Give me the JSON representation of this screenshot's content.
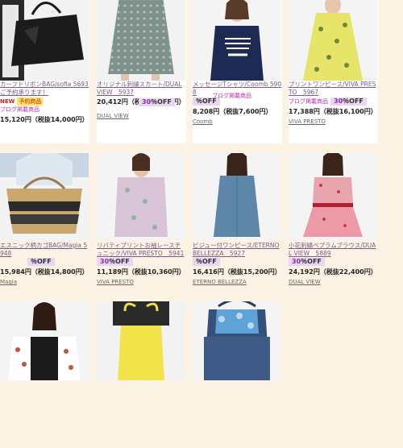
{
  "products": [
    {
      "title": "カーフドリボンBAG/sofia 5693 ご予約承ります！",
      "new_label": "NEW",
      "reserve_label": "予約商品",
      "blog_label": "ブログ掲載商品",
      "price": "15,120円（税抜14,000円）",
      "brand": "",
      "discount": ""
    },
    {
      "title": "オリジナル刺繍スカート/DUAL VIEW　5937",
      "discount": "30％OFF",
      "price": "20,412円（税抜18,900円）",
      "brand": "DUAL VIEW"
    },
    {
      "title": "メッセージTシャツ/Coomb 5908",
      "discount": "％OFF",
      "blog_label": "ブログ掲載商品",
      "price": "8,208円（税抜7,600円）",
      "brand": "Coomb"
    },
    {
      "title": "プリントワンピース/VIVA PRESTO　5967",
      "blog_label": "ブログ掲載商品",
      "discount": "30％OFF",
      "price": "17,388円（税抜16,100円）",
      "brand": "VIVA PRESTO"
    },
    {
      "title": "エスニック柄カゴBAG/Magia 5948",
      "discount": "％OFF",
      "price": "15,984円（税抜14,800円）",
      "brand": "Magia"
    },
    {
      "title": "リバティプリントお袖レースチュニック/VIVA PRESTO　5941",
      "discount": "30％OFF",
      "price": "11,189円（税抜10,360円）",
      "brand": "VIVA PRESTO"
    },
    {
      "title": "ビジュー付ワンピース/ETERNO BELLEZZA　5927",
      "discount": "％OFF",
      "price": "16,416円（税抜15,200円）",
      "brand": "ETERNO BELLEZZA"
    },
    {
      "title": "小花刺繍ペプラムブラウス/DUAL VIEW　5889",
      "discount": "30％OFF",
      "price": "24,192円（税抜22,400円）",
      "brand": "DUAL VIEW"
    },
    {
      "title": ""
    },
    {
      "title": ""
    },
    {
      "title": ""
    }
  ]
}
